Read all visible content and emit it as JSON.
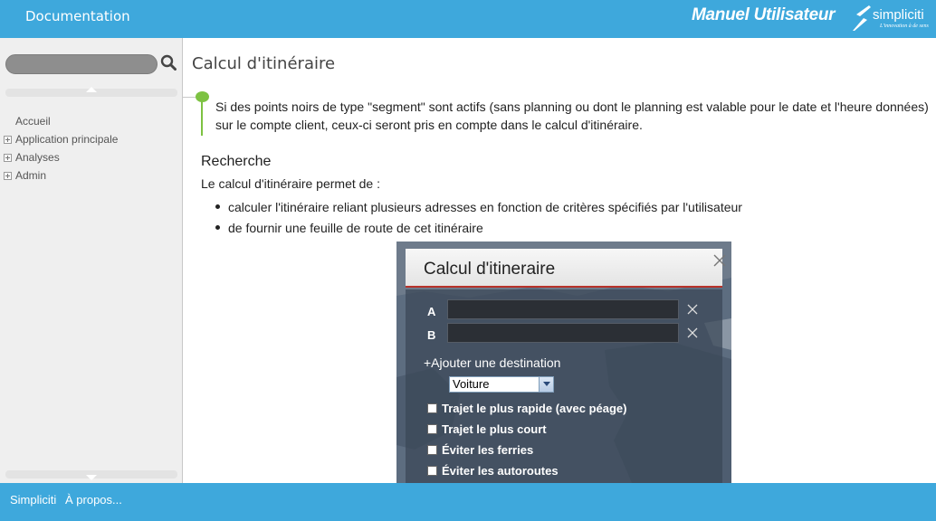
{
  "header": {
    "title": "Documentation",
    "manual_label": "Manuel Utilisateur",
    "logo_name": "simpliciti",
    "logo_tagline": "L'innovation à de sens"
  },
  "sidebar": {
    "search_placeholder": "",
    "tree": [
      {
        "label": "Accueil",
        "expandable": false
      },
      {
        "label": "Application principale",
        "expandable": true
      },
      {
        "label": "Analyses",
        "expandable": true
      },
      {
        "label": "Admin",
        "expandable": true
      }
    ]
  },
  "main": {
    "title": "Calcul d'itinéraire",
    "note": "Si des points noirs de type \"segment\" sont actifs (sans planning ou dont le planning est valable pour le date et l'heure données) sur le compte client, ceux-ci seront pris en compte dans le calcul d'itinéraire.",
    "section_heading": "Recherche",
    "intro": "Le calcul d'itinéraire permet de :",
    "bullets": [
      "calculer l'itinéraire reliant plusieurs adresses en fonction de critères spécifiés par l'utilisateur",
      "de fournir une feuille de route de cet itinéraire"
    ]
  },
  "screenshot": {
    "dialog_title": "Calcul d'itineraire",
    "rows": [
      {
        "label": "A",
        "value": ""
      },
      {
        "label": "B",
        "value": ""
      }
    ],
    "clear_label": "X",
    "add_destination": "+Ajouter une destination",
    "vehicle_selected": "Voiture",
    "options": [
      "Trajet le plus rapide (avec péage)",
      "Trajet le plus court",
      "Éviter les ferries",
      "Éviter les autoroutes"
    ]
  },
  "footer": {
    "links": [
      "Simpliciti",
      "À propos..."
    ]
  },
  "colors": {
    "brand_blue": "#3ea8dc",
    "note_green": "#7dc242",
    "dialog_accent": "#b8322a"
  }
}
